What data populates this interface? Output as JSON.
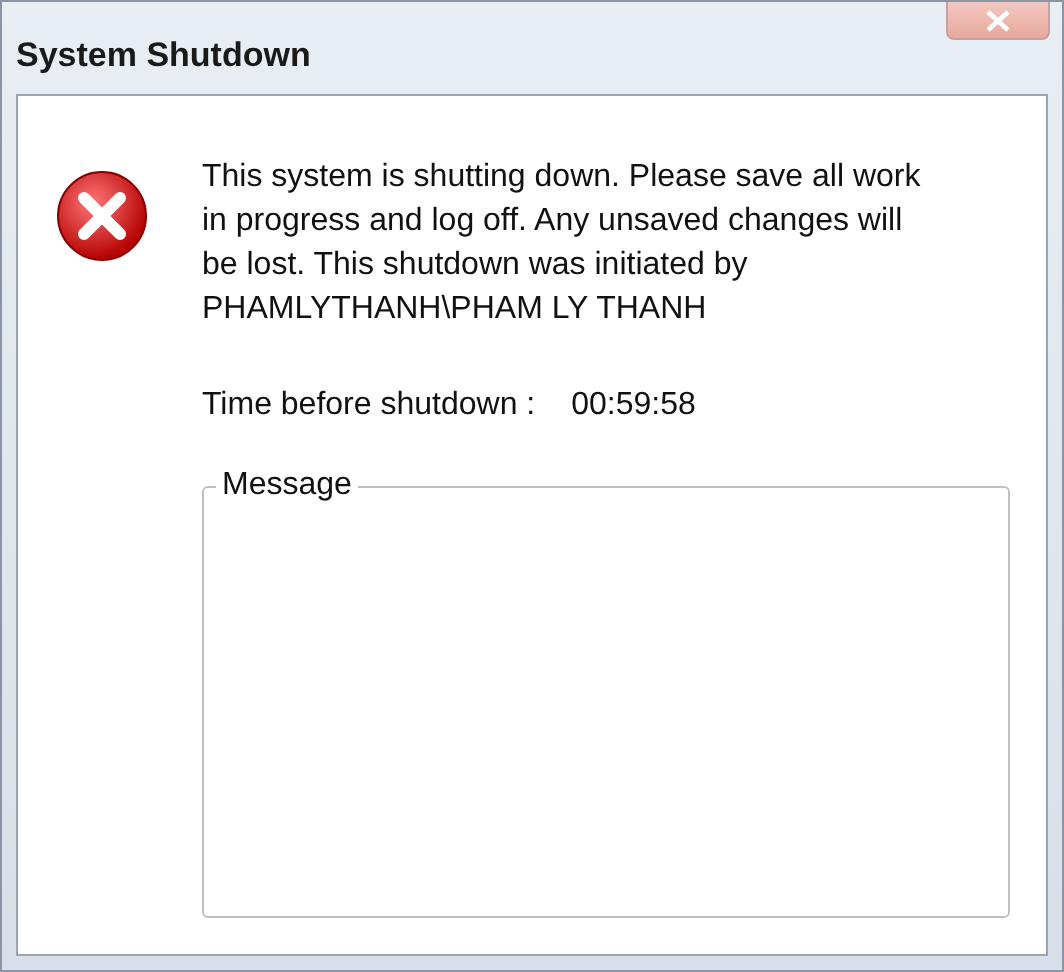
{
  "window": {
    "title": "System Shutdown"
  },
  "message": "This system is shutting down. Please save all work in progress and log off. Any unsaved changes will be lost. This shutdown was initiated by PHAMLYTHANH\\PHAM LY THANH",
  "countdown": {
    "label": "Time before shutdown :",
    "value": "00:59:58"
  },
  "message_group": {
    "label": "Message"
  }
}
